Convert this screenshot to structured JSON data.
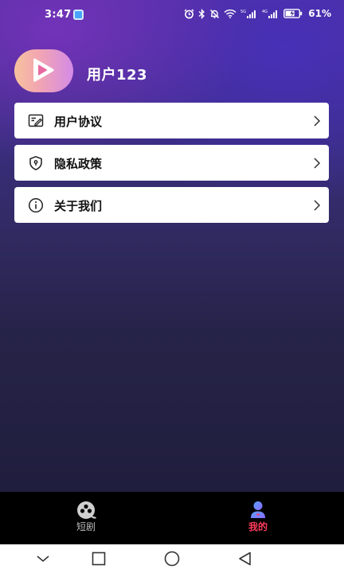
{
  "status_bar": {
    "time": "3:47",
    "battery_percent": "61%",
    "signal_1_label": "5G",
    "signal_2_label": "4G"
  },
  "profile": {
    "username": "用户123",
    "avatar_icon": "play-logo-icon"
  },
  "menu": {
    "items": [
      {
        "label": "用户协议",
        "icon": "agreement-document-icon"
      },
      {
        "label": "隐私政策",
        "icon": "shield-lock-icon"
      },
      {
        "label": "关于我们",
        "icon": "info-circle-icon"
      }
    ]
  },
  "tab_bar": {
    "tabs": [
      {
        "label": "短剧",
        "icon": "short-drama-icon",
        "active": false
      },
      {
        "label": "我的",
        "icon": "profile-user-icon",
        "active": true
      }
    ]
  },
  "colors": {
    "accent": "#ff3b5c",
    "card_background": "#ffffff",
    "tab_bar_background": "#000000",
    "inactive_tab": "#b9b9b9"
  },
  "system_nav": {
    "buttons": [
      "chevron-down-icon",
      "recents-square-icon",
      "home-circle-icon",
      "back-triangle-icon"
    ]
  }
}
